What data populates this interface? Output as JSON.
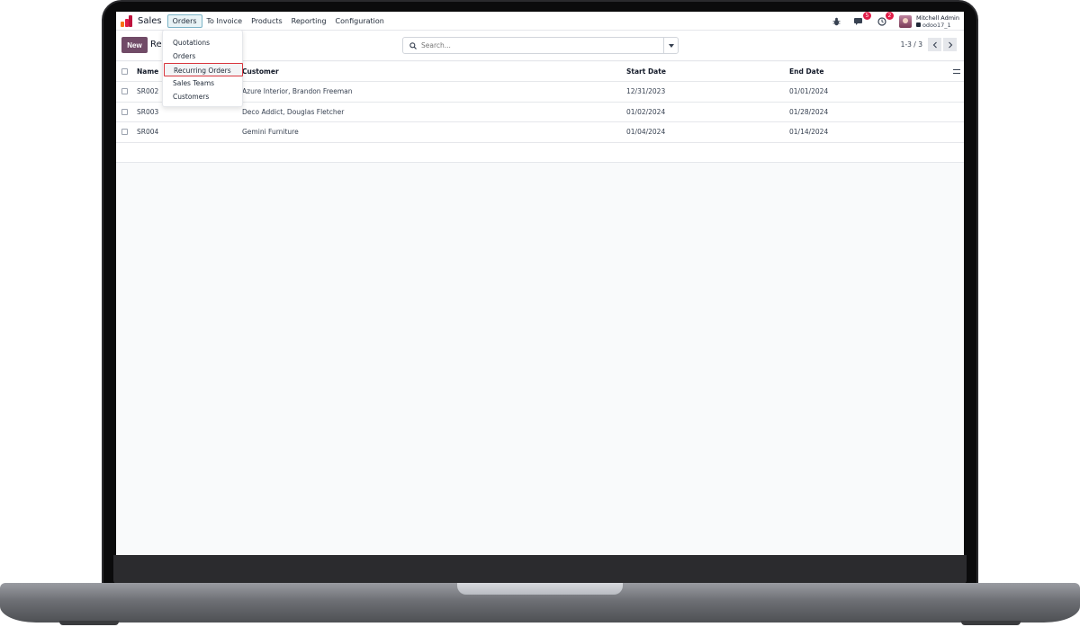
{
  "app": {
    "name": "Sales"
  },
  "nav": {
    "items": [
      "Orders",
      "To Invoice",
      "Products",
      "Reporting",
      "Configuration"
    ]
  },
  "systray": {
    "chat_badge": "5",
    "activity_badge": "2",
    "user_name": "Mitchell Admin",
    "database": "odoo17_1"
  },
  "control": {
    "new_label": "New",
    "breadcrumb": "Rec",
    "search_placeholder": "Search...",
    "pager": "1-3 / 3"
  },
  "dropdown": {
    "items": [
      "Quotations",
      "Orders",
      "Recurring Orders",
      "Sales Teams",
      "Customers"
    ],
    "highlighted": "Recurring Orders"
  },
  "table": {
    "columns": [
      "Name",
      "Customer",
      "Start Date",
      "End Date"
    ],
    "rows": [
      {
        "name": "SR002",
        "customer": "Azure Interior, Brandon Freeman",
        "start": "12/31/2023",
        "end": "01/01/2024"
      },
      {
        "name": "SR003",
        "customer": "Deco Addict, Douglas Fletcher",
        "start": "01/02/2024",
        "end": "01/28/2024"
      },
      {
        "name": "SR004",
        "customer": "Gemini Furniture",
        "start": "01/04/2024",
        "end": "01/14/2024"
      }
    ]
  },
  "colors": {
    "brand": "#714b67",
    "badge": "#e11d48",
    "highlight_border": "#d9363e"
  }
}
